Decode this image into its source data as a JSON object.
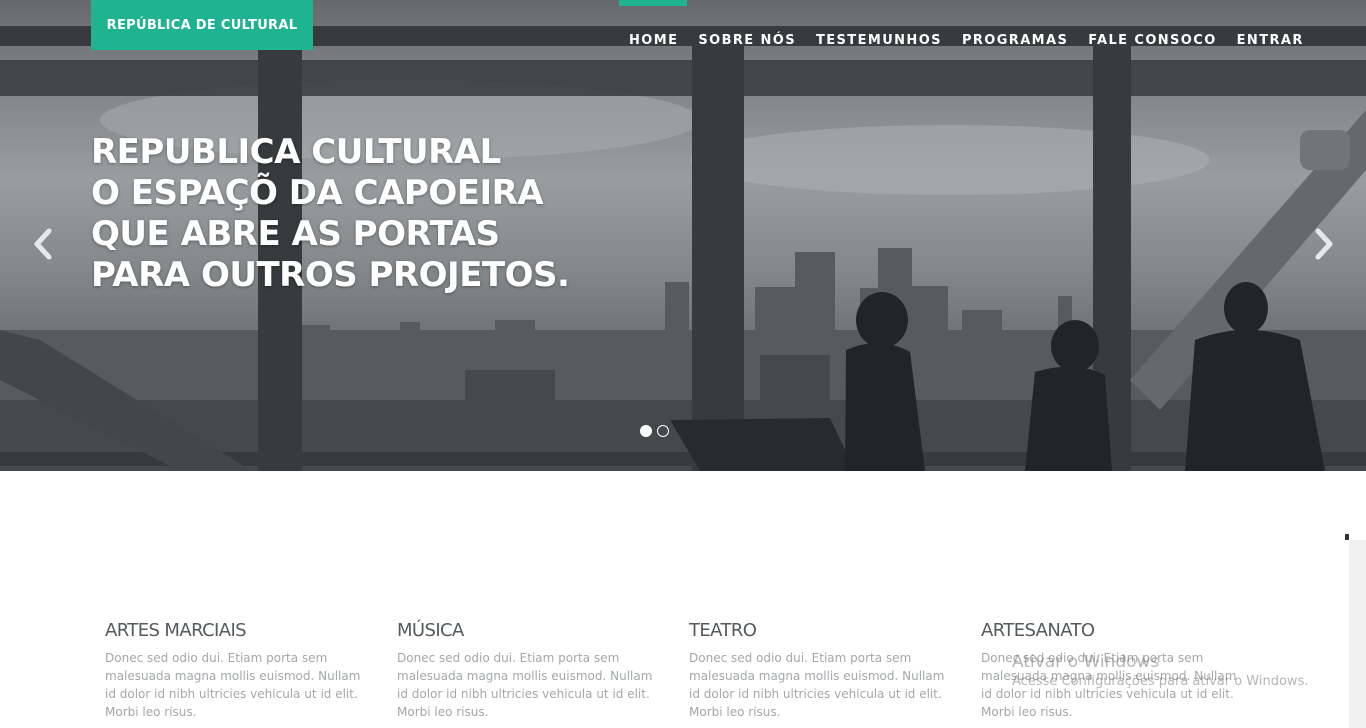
{
  "brand": {
    "label": "REPÚBLICA DE CULTURAL",
    "accent_color": "#1fb392"
  },
  "nav": {
    "items": [
      {
        "label": "HOME",
        "active": true
      },
      {
        "label": "SOBRE NÓS"
      },
      {
        "label": "TESTEMUNHOS"
      },
      {
        "label": "PROGRAMAS"
      },
      {
        "label": "FALE CONSOCO"
      },
      {
        "label": "ENTRAR"
      }
    ]
  },
  "hero": {
    "headline_lines": [
      "REPUBLICA CULTURAL",
      "O ESPAÇÕ DA CAPOEIRA",
      "QUE ABRE AS PORTAS",
      "PARA OUTROS PROJETOS."
    ],
    "prev_icon": "chevron-left-icon",
    "next_icon": "chevron-right-icon",
    "slides": {
      "count": 2,
      "active_index": 1
    }
  },
  "features": [
    {
      "title": "ARTES MARCIAIS",
      "text": "Donec sed odio dui. Etiam porta sem malesuada magna mollis euismod. Nullam id dolor id nibh ultricies vehicula ut id elit. Morbi leo risus."
    },
    {
      "title": "MÚSICA",
      "text": "Donec sed odio dui. Etiam porta sem malesuada magna mollis euismod. Nullam id dolor id nibh ultricies vehicula ut id elit. Morbi leo risus."
    },
    {
      "title": "TEATRO",
      "text": "Donec sed odio dui. Etiam porta sem malesuada magna mollis euismod. Nullam id dolor id nibh ultricies vehicula ut id elit. Morbi leo risus."
    },
    {
      "title": "ARTESANATO",
      "text": "Donec sed odio dui. Etiam porta sem malesuada magna mollis euismod. Nullam id dolor id nibh ultricies vehicula ut id elit. Morbi leo risus."
    }
  ],
  "watermark": {
    "title": "Ativar o Windows",
    "subtitle": "Acesse Configurações para ativar o Windows."
  }
}
